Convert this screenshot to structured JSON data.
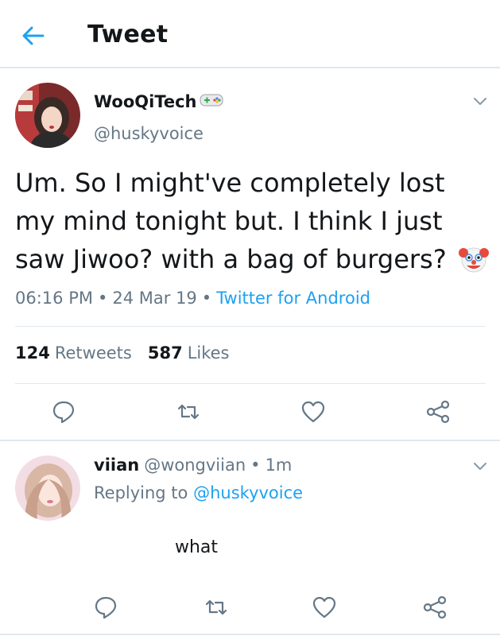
{
  "header": {
    "title": "Tweet",
    "back_icon": "arrow-left-icon"
  },
  "tweet": {
    "display_name": "WooQiTech",
    "name_emoji": "gamepad-emoji",
    "handle": "@huskyvoice",
    "text": "Um. So I might've completely lost my mind tonight but. I think I just saw Jiwoo? with a bag of burgers?",
    "text_emoji": "clown-face-emoji",
    "time": "06:16 PM",
    "date": "24 Mar 19",
    "separator": "•",
    "source": "Twitter for Android",
    "retweets_count": "124",
    "retweets_label": "Retweets",
    "likes_count": "587",
    "likes_label": "Likes",
    "actions": [
      "reply-icon",
      "retweet-icon",
      "like-icon",
      "share-icon"
    ]
  },
  "reply": {
    "display_name": "viian",
    "handle": "@wongviian",
    "separator": "•",
    "time_ago": "1m",
    "replying_label": "Replying to",
    "replying_handle": "@huskyvoice",
    "text": "what",
    "actions": [
      "reply-icon",
      "retweet-icon",
      "like-icon",
      "share-icon"
    ]
  },
  "colors": {
    "accent": "#1da1f2",
    "text_primary": "#14171a",
    "text_secondary": "#657786",
    "divider": "#e1e8ed",
    "icon": "#657786"
  }
}
